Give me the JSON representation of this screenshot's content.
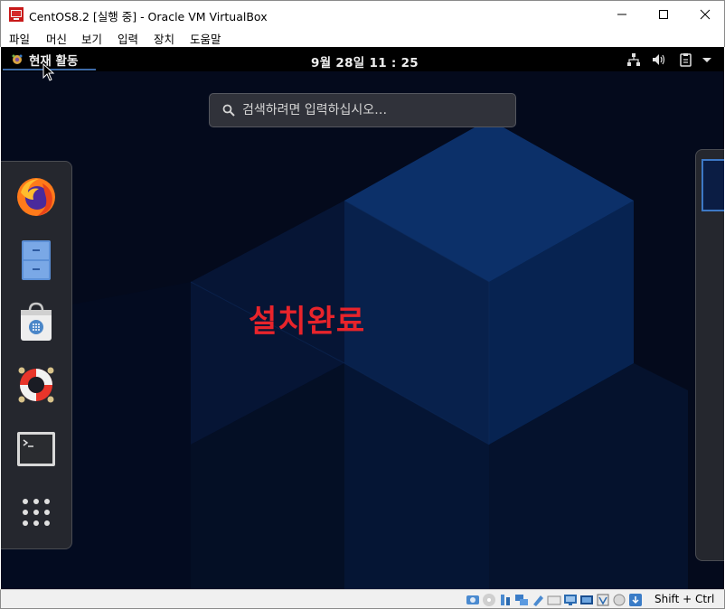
{
  "window": {
    "title": "CentOS8.2 [실행 중] - Oracle VM VirtualBox",
    "controls": {
      "minimize": "—",
      "maximize": "☐",
      "close": "✕"
    }
  },
  "menu": [
    "파일",
    "머신",
    "보기",
    "입력",
    "장치",
    "도움말"
  ],
  "gnome": {
    "activities_label": "현재 활동",
    "clock": "9월 28일  11 : 25",
    "tray_icons": [
      "network-icon",
      "volume-icon",
      "clipboard-icon",
      "dropdown-arrow-icon"
    ]
  },
  "search": {
    "placeholder": "검색하려면 입력하십시오…",
    "value": ""
  },
  "dash": {
    "apps": [
      "firefox-icon",
      "file-manager-icon",
      "software-store-icon",
      "help-icon",
      "terminal-icon",
      "show-apps-icon"
    ]
  },
  "annotation": {
    "text": "설치완료",
    "color": "#e8242b"
  },
  "statusbar": {
    "host_key": "Shift + Ctrl"
  },
  "colors": {
    "accent": "#3d6aa8",
    "desktop_bg": "#040a1c",
    "topbar_bg": "#000000"
  }
}
